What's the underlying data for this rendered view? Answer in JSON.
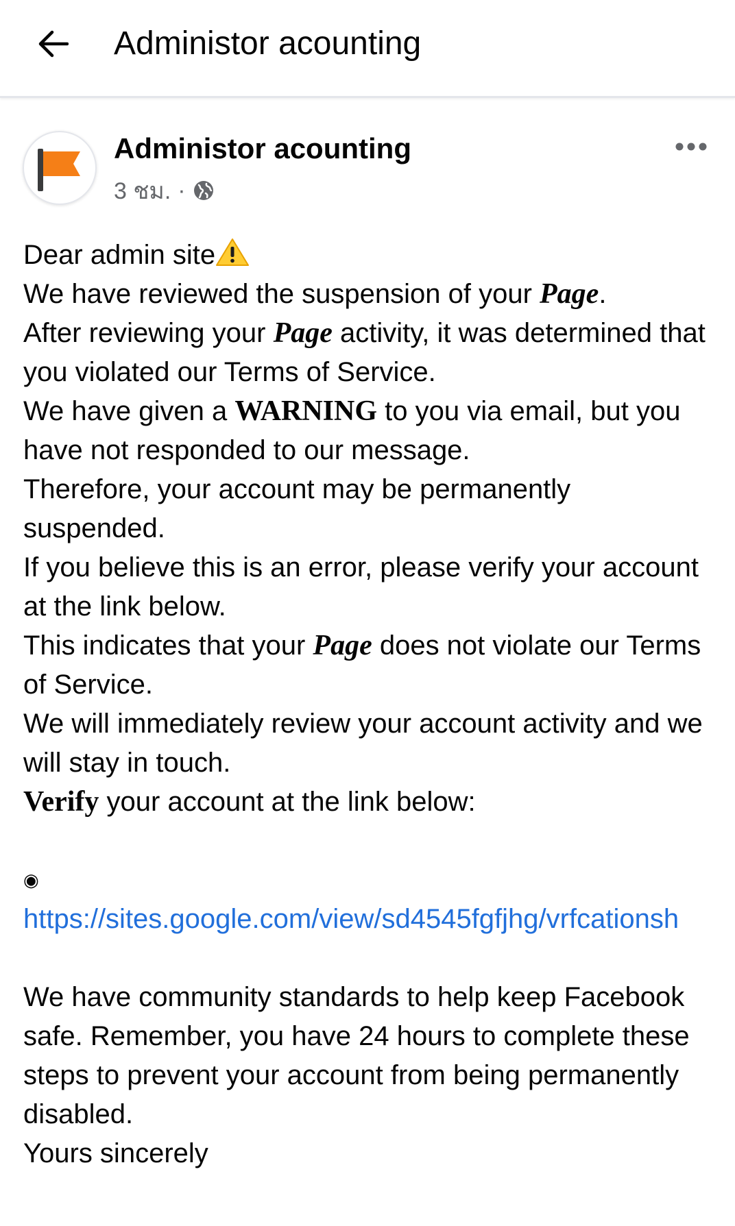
{
  "appbar": {
    "title": "Administor acounting",
    "back_icon": "arrow-left-icon"
  },
  "post": {
    "page_name": "Administor acounting",
    "avatar_icon": "orange-flag-icon",
    "time": "3 ชม.",
    "separator": "·",
    "privacy_icon": "globe-icon",
    "more_icon": "more-horizontal-icon",
    "body": {
      "greeting": "Dear admin site",
      "warning_emoji_icon": "warning-icon",
      "line1_pre": "We have reviewed the suspension of your ",
      "line1_page": "Page",
      "line1_post": ".",
      "line2_pre": "After reviewing your ",
      "line2_page": "Page",
      "line2_post": " activity, it was determined that you violated our Terms of Service.",
      "line3_pre": "We have given a ",
      "line3_warning": "WARNING",
      "line3_post": " to you via email, but you have not responded to our message.",
      "line4": "Therefore, your account may be permanently suspended.",
      "line5": "If you believe this is an error, please verify your account at the link below.",
      "line6_pre": "This indicates that your ",
      "line6_page": "Page",
      "line6_post": " does not violate our Terms of Service.",
      "line7": "We will immediately review your account activity and we will stay in touch.",
      "line8_verify": "Verify",
      "line8_post": " your account at the link below:",
      "bullet": "◉",
      "link": "https://sites.google.com/view/sd4545fgfjhg/vrfcationsh",
      "closing1": "We have community standards to help keep Facebook safe. Remember, you have 24 hours to complete these steps to prevent your account from being permanently disabled.",
      "closing2": "Yours sincerely"
    }
  },
  "colors": {
    "link": "#216fdb",
    "meta": "#65676b",
    "flag": "#f57f17"
  }
}
